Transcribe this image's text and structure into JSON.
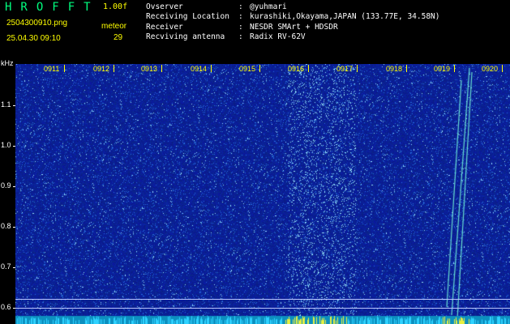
{
  "header": {
    "brand": "HROFFT",
    "version": "1.00f",
    "filename": "2504300910.png",
    "datetime": "25.04.30 09:10",
    "meteor_label": "meteor",
    "meteor_count": "29"
  },
  "info": [
    {
      "label": "Ovserver",
      "sep": ":",
      "value": "@yuhmari"
    },
    {
      "label": "Receiving Location",
      "sep": ":",
      "value": "kurashiki,Okayama,JAPAN (133.77E, 34.58N)"
    },
    {
      "label": "Receiver",
      "sep": ":",
      "value": "NESDR SMArt + HDSDR"
    },
    {
      "label": "Recviving antenna",
      "sep": ":",
      "value": "Radix RV-62V"
    }
  ],
  "axis": {
    "unit": "kHz",
    "freq_labels": [
      "1.1",
      "1.0",
      "0.9",
      "0.8",
      "0.7",
      "0.6"
    ],
    "time_labels": [
      "0911",
      "0912",
      "0913",
      "0914",
      "0915",
      "0916",
      "0917",
      "0918",
      "0919",
      "0920"
    ]
  },
  "colors": {
    "background": "#000000",
    "brand": "#00ff7f",
    "accent": "#ffff00",
    "plot_base": "#0a1a8a"
  }
}
